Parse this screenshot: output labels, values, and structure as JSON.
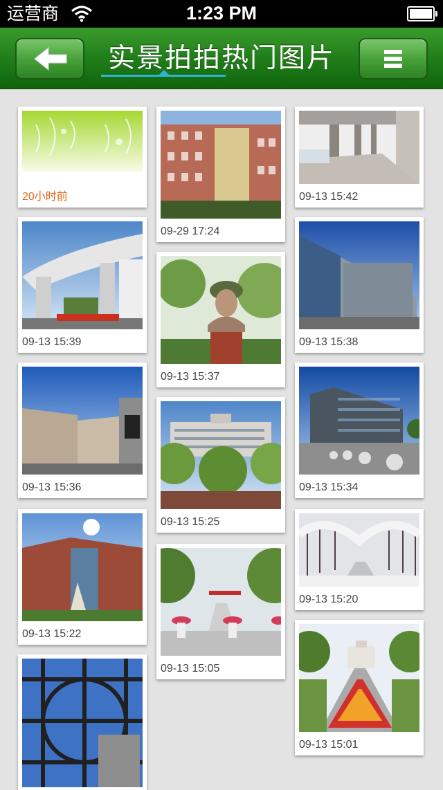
{
  "statusbar": {
    "carrier": "运营商",
    "time": "1:23 PM"
  },
  "navbar": {
    "title": "实景拍拍热门图片"
  },
  "icons": {
    "back": "arrow-left-icon",
    "menu": "hamburger-menu-icon",
    "wifi": "wifi-icon",
    "battery": "battery-icon"
  },
  "gallery": {
    "columns": [
      {
        "cards": [
          {
            "caption": "20小时前",
            "highlight": true,
            "alt": "green floral banner"
          },
          {
            "caption": "09-13 15:39",
            "alt": "university gate arch"
          },
          {
            "caption": "09-13 15:36",
            "alt": "campus building under blue sky"
          },
          {
            "caption": "09-13 15:22",
            "alt": "brick building with sun"
          },
          {
            "caption": "",
            "alt": "steel lattice structure"
          }
        ]
      },
      {
        "cards": [
          {
            "caption": "09-29 17:24",
            "alt": "red brick building with lattice"
          },
          {
            "caption": "09-13 15:37",
            "alt": "bust statue among trees"
          },
          {
            "caption": "09-13 15:25",
            "alt": "main building with garden"
          },
          {
            "caption": "09-13 15:05",
            "alt": "avenue with flower planters"
          }
        ]
      },
      {
        "cards": [
          {
            "caption": "09-13 15:42",
            "alt": "corridor with columns"
          },
          {
            "caption": "09-13 15:38",
            "alt": "modern glass building"
          },
          {
            "caption": "09-13 15:34",
            "alt": "library with stone balls"
          },
          {
            "caption": "09-13 15:20",
            "alt": "snowy tree-lined road"
          },
          {
            "caption": "09-13 15:01",
            "alt": "flower bed avenue to building"
          }
        ]
      }
    ]
  }
}
